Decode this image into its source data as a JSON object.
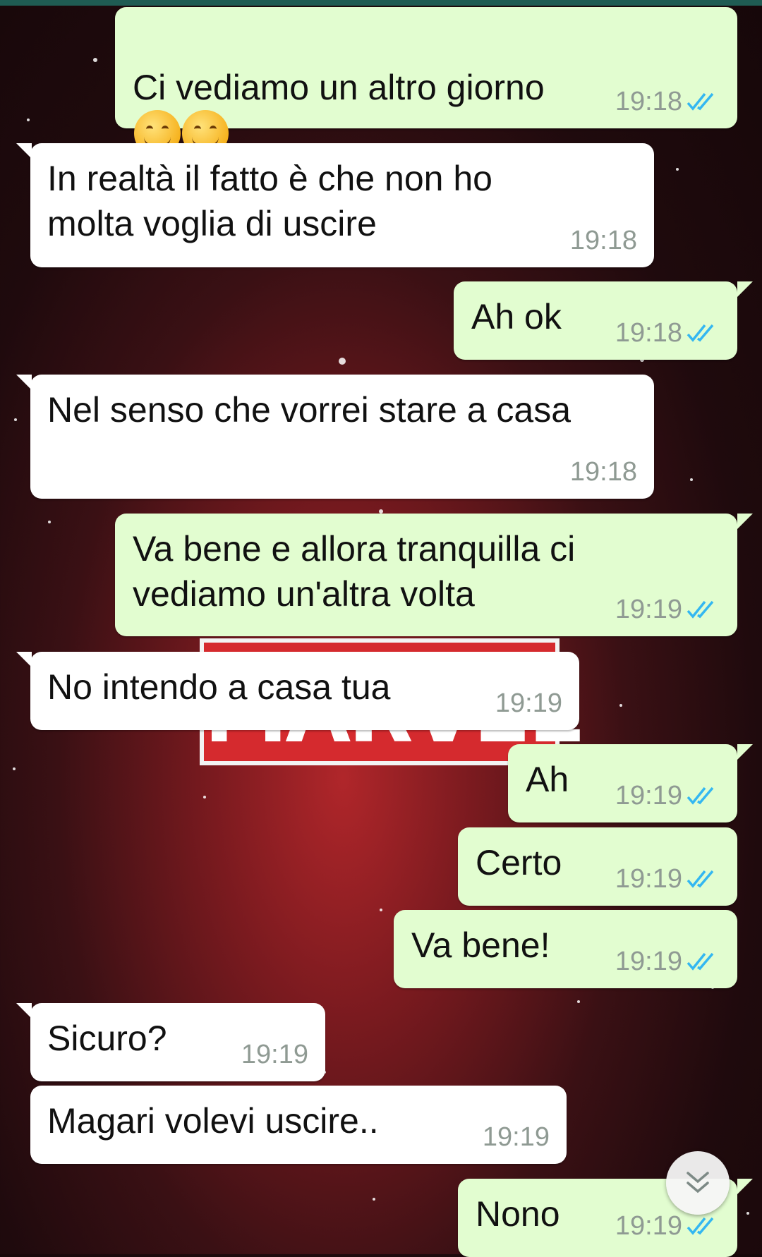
{
  "colors": {
    "incoming_bubble": "#ffffff",
    "outgoing_bubble": "#e2fdd0",
    "tick_blue": "#34b7f1",
    "timestamp": "#8f9a93"
  },
  "wallpaper": {
    "logo_text": "MARVEL"
  },
  "messages": [
    {
      "direction": "out",
      "text": "Ci vediamo un altro giorno",
      "emoji": [
        "smiling-face-icon",
        "smiling-face-icon"
      ],
      "time": "19:18",
      "status": "read"
    },
    {
      "direction": "in",
      "text": "In realtà il fatto è che non ho\nmolta voglia di uscire",
      "time": "19:18"
    },
    {
      "direction": "out",
      "text": "Ah ok",
      "time": "19:18",
      "status": "read"
    },
    {
      "direction": "in",
      "text": "Nel senso che vorrei stare a casa",
      "time": "19:18"
    },
    {
      "direction": "out",
      "text": "Va bene e allora tranquilla ci\nvediamo un'altra volta",
      "time": "19:19",
      "status": "read"
    },
    {
      "direction": "in",
      "text": "No intendo a casa tua",
      "time": "19:19"
    },
    {
      "direction": "out",
      "text": "Ah",
      "time": "19:19",
      "status": "read"
    },
    {
      "direction": "out",
      "text": "Certo",
      "time": "19:19",
      "status": "read"
    },
    {
      "direction": "out",
      "text": "Va bene!",
      "time": "19:19",
      "status": "read"
    },
    {
      "direction": "in",
      "text": "Sicuro?",
      "time": "19:19"
    },
    {
      "direction": "in",
      "text": "Magari volevi uscire..",
      "time": "19:19"
    },
    {
      "direction": "out",
      "text": "Nono",
      "time": "19:19",
      "status": "read"
    }
  ],
  "scroll_button": {
    "icon": "double-chevron-down-icon"
  }
}
